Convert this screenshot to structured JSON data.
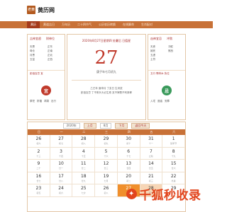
{
  "header": {
    "logo_icon": "calendar-logo-icon",
    "logo_box_text": "老黄历",
    "logo_text": "黄历网"
  },
  "nav": {
    "items": [
      {
        "label": "黄历",
        "active": true
      },
      {
        "label": "黄道吉日",
        "active": false
      },
      {
        "label": "万年历",
        "active": false
      },
      {
        "label": "二十四节气",
        "active": false
      },
      {
        "label": "公历农历转换",
        "active": false
      },
      {
        "label": "在线算命",
        "active": false
      },
      {
        "label": "生肖配对",
        "active": false
      }
    ]
  },
  "left": {
    "head_a": "吉神宜趋",
    "head_b": "财神位",
    "body": [
      "天恩",
      "正东",
      "母仓",
      "正南",
      "月恩",
      "正北",
      "五富",
      "正西"
    ],
    "yi_title": "彭祖百忌 宜",
    "yi_circle": "宜",
    "yi_items": [
      "祭祀",
      "祈福",
      "求嗣",
      "出行"
    ]
  },
  "middle": {
    "date_line": "2020年8月27日星期四  处暑后  日值星",
    "big_day": "27",
    "lunar": "庚子年七月初九",
    "note_1": "乙巳年 庚申月 丁亥日 生肖鼠",
    "note_2": "彭祖百忌 丁不剃头头必生疮 亥不嫁娶不利新郎"
  },
  "right": {
    "head_a": "凶神宜忌",
    "head_b": "冲煞",
    "body": [
      "天吏",
      "冲蛇",
      "致死",
      "煞西",
      "五虚",
      "",
      "土符",
      ""
    ],
    "ji_title": "五行 劈林木 执位",
    "ji_circle": "忌",
    "ji_items": [
      "入宅",
      "造庙",
      "安葬"
    ]
  },
  "calendar": {
    "year": "2020年",
    "month": "8月",
    "prev": "上月",
    "next": "下月",
    "today_btn": "返回今天",
    "weekdays": [
      "日",
      "一",
      "二",
      "三",
      "四",
      "五",
      "六"
    ],
    "days": [
      {
        "d": "26",
        "l": "初六"
      },
      {
        "d": "27",
        "l": "初七"
      },
      {
        "d": "28",
        "l": "初八"
      },
      {
        "d": "29",
        "l": "初九"
      },
      {
        "d": "30",
        "l": "初十"
      },
      {
        "d": "31",
        "l": "十一"
      },
      {
        "d": "1",
        "l": "建军节"
      },
      {
        "d": "2",
        "l": "十三"
      },
      {
        "d": "3",
        "l": "十四"
      },
      {
        "d": "4",
        "l": "十五"
      },
      {
        "d": "5",
        "l": "十六"
      },
      {
        "d": "6",
        "l": "十七"
      },
      {
        "d": "7",
        "l": "立秋"
      },
      {
        "d": "8",
        "l": "十九"
      },
      {
        "d": "9",
        "l": "二十"
      },
      {
        "d": "10",
        "l": "廿一"
      },
      {
        "d": "11",
        "l": "廿二"
      },
      {
        "d": "12",
        "l": "廿三"
      },
      {
        "d": "13",
        "l": "廿四"
      },
      {
        "d": "14",
        "l": "廿五"
      },
      {
        "d": "15",
        "l": "廿六"
      },
      {
        "d": "16",
        "l": "廿七"
      },
      {
        "d": "17",
        "l": "廿八"
      },
      {
        "d": "18",
        "l": "廿九"
      },
      {
        "d": "19",
        "l": "七月"
      },
      {
        "d": "20",
        "l": "初二"
      },
      {
        "d": "21",
        "l": "初三"
      },
      {
        "d": "22",
        "l": "处暑"
      },
      {
        "d": "23",
        "l": "初五"
      },
      {
        "d": "24",
        "l": "初六"
      },
      {
        "d": "25",
        "l": "七夕"
      },
      {
        "d": "26",
        "l": "初八"
      },
      {
        "d": "27",
        "l": "初九"
      },
      {
        "d": "28",
        "l": "初十"
      },
      {
        "d": "29",
        "l": "十一"
      }
    ]
  },
  "watermark": {
    "text": "千狐秒收录",
    "icon": "fox-icon"
  },
  "colors": {
    "nav": "#c87137",
    "nav_active": "#a43a1c",
    "accent_red": "#c0392b",
    "today": "#f08f2c",
    "watermark": "#e2451d"
  }
}
